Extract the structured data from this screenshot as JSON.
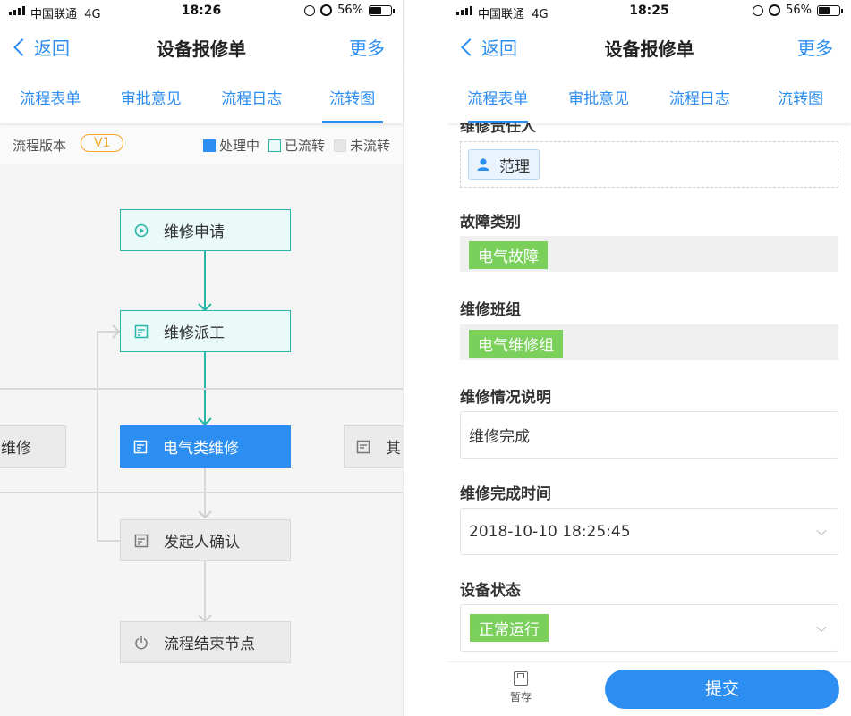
{
  "statusbar": {
    "carrier": "中国联通",
    "network": "4G",
    "battery": "56%",
    "battery_level": 0.56
  },
  "left": {
    "time": "18:26",
    "nav": {
      "back": "返回",
      "title": "设备报修单",
      "more": "更多"
    },
    "tabs": [
      "流程表单",
      "审批意见",
      "流程日志",
      "流转图"
    ],
    "active_tab": 3,
    "version_label": "流程版本",
    "version": "V1",
    "legend": {
      "processing": "处理中",
      "transferred": "已流转",
      "pending": "未流转"
    },
    "nodes": {
      "apply": "维修申请",
      "dispatch": "维修派工",
      "electric": "电气类维修",
      "left_partial": "维修",
      "right_partial": "其",
      "confirm": "发起人确认",
      "end": "流程结束节点"
    }
  },
  "right": {
    "time": "18:25",
    "nav": {
      "back": "返回",
      "title": "设备报修单",
      "more": "更多"
    },
    "tabs": [
      "流程表单",
      "审批意见",
      "流程日志",
      "流转图"
    ],
    "active_tab": 0,
    "form": {
      "responsible_label": "维修责任人",
      "responsible_user": "范理",
      "fault_type_label": "故障类别",
      "fault_type": "电气故障",
      "team_label": "维修班组",
      "team": "电气维修组",
      "desc_label": "维修情况说明",
      "desc": "维修完成",
      "finish_time_label": "维修完成时间",
      "finish_time": "2018-10-10 18:25:45",
      "status_label": "设备状态",
      "status": "正常运行"
    },
    "footer": {
      "save": "暂存",
      "submit": "提交"
    }
  }
}
